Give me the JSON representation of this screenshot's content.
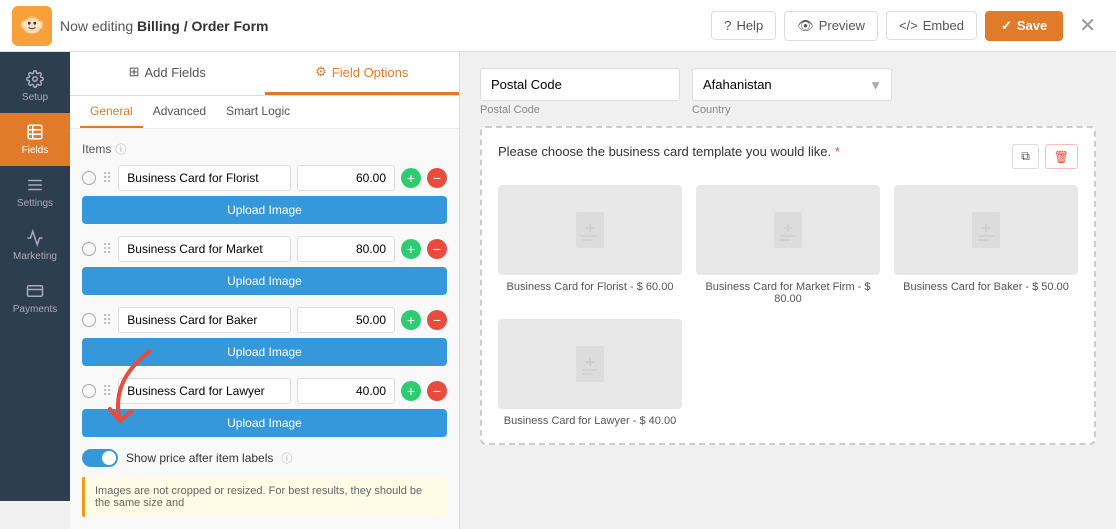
{
  "topbar": {
    "editing_prefix": "Now editing ",
    "form_name": "Billing / Order Form",
    "help_label": "Help",
    "preview_label": "Preview",
    "embed_label": "Embed",
    "save_label": "Save"
  },
  "sidebar": {
    "items": [
      {
        "id": "setup",
        "label": "Setup",
        "active": false
      },
      {
        "id": "fields",
        "label": "Fields",
        "active": true
      },
      {
        "id": "settings",
        "label": "Settings",
        "active": false
      },
      {
        "id": "marketing",
        "label": "Marketing",
        "active": false
      },
      {
        "id": "payments",
        "label": "Payments",
        "active": false
      }
    ]
  },
  "panel": {
    "tabs": [
      {
        "id": "add-fields",
        "label": "Add Fields",
        "active": false
      },
      {
        "id": "field-options",
        "label": "Field Options",
        "active": true
      }
    ],
    "sub_tabs": [
      {
        "id": "general",
        "label": "General",
        "active": true
      },
      {
        "id": "advanced",
        "label": "Advanced",
        "active": false
      },
      {
        "id": "smart-logic",
        "label": "Smart Logic",
        "active": false
      }
    ],
    "items_label": "Items",
    "fields": [
      {
        "name": "Business Card for Florist",
        "price": "60.00"
      },
      {
        "name": "Business Card for Market",
        "price": "80.00"
      },
      {
        "name": "Business Card for Baker",
        "price": "50.00"
      },
      {
        "name": "Business Card for Lawyer",
        "price": "40.00"
      }
    ],
    "upload_button_label": "Upload Image",
    "toggle_label": "Show price after item labels",
    "info_text": "Images are not cropped or resized.\nFor best results, they should be the same size and"
  },
  "content": {
    "postal_code_value": "Postal Code",
    "postal_code_label": "Postal Code",
    "country_value": "Afahanistan",
    "country_label": "Country",
    "choices_question": "Please choose the business card template you would like.",
    "cards": [
      {
        "label": "Business Card for Florist - $ 60.00"
      },
      {
        "label": "Business Card for Market Firm - $ 80.00"
      },
      {
        "label": "Business Card for Baker - $ 50.00"
      },
      {
        "label": "Business Card for Lawyer - $ 40.00"
      }
    ]
  }
}
